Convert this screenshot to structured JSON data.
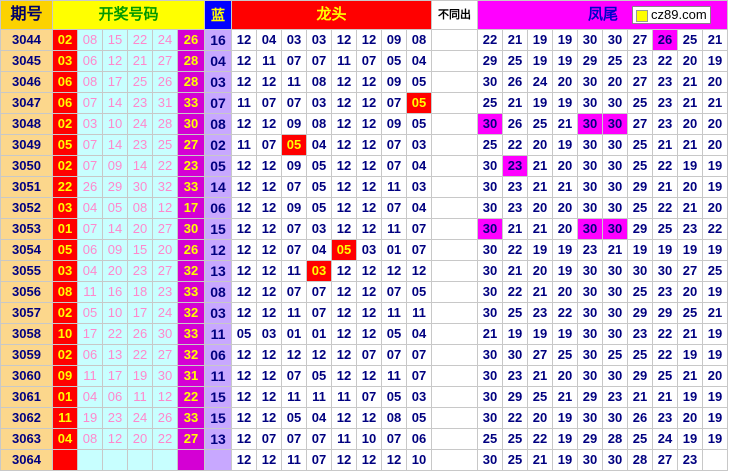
{
  "headers": {
    "period": "期号",
    "open_numbers": "开奖号码",
    "blue": "蓝",
    "dragon_head": "龙头",
    "not_same": "不同出",
    "phoenix_tail": "凤尾",
    "site": "cz89.com"
  },
  "rows": [
    {
      "period": "3044",
      "reds": [
        "02",
        "08",
        "15",
        "22",
        "24",
        "26"
      ],
      "blue": "16",
      "dragon": [
        "12",
        "04",
        "03",
        "03",
        "12",
        "12",
        "09",
        "08"
      ],
      "dragon_hit": -1,
      "tail": [
        "22",
        "21",
        "19",
        "19",
        "30",
        "30",
        "27",
        "26",
        "25",
        "21"
      ],
      "tail_hits": [
        7
      ]
    },
    {
      "period": "3045",
      "reds": [
        "03",
        "06",
        "12",
        "21",
        "27",
        "28"
      ],
      "blue": "04",
      "dragon": [
        "12",
        "11",
        "07",
        "07",
        "11",
        "07",
        "05",
        "04"
      ],
      "dragon_hit": -1,
      "tail": [
        "29",
        "25",
        "19",
        "19",
        "29",
        "25",
        "23",
        "22",
        "20",
        "19"
      ],
      "tail_hits": []
    },
    {
      "period": "3046",
      "reds": [
        "06",
        "08",
        "17",
        "25",
        "26",
        "28"
      ],
      "blue": "03",
      "dragon": [
        "12",
        "12",
        "11",
        "08",
        "12",
        "12",
        "09",
        "05"
      ],
      "dragon_hit": -1,
      "tail": [
        "30",
        "26",
        "24",
        "20",
        "30",
        "20",
        "27",
        "23",
        "21",
        "20"
      ],
      "tail_hits": []
    },
    {
      "period": "3047",
      "reds": [
        "06",
        "07",
        "14",
        "23",
        "31",
        "33"
      ],
      "blue": "07",
      "dragon": [
        "11",
        "07",
        "07",
        "03",
        "12",
        "12",
        "07",
        "05"
      ],
      "dragon_hit": 7,
      "tail": [
        "25",
        "21",
        "19",
        "19",
        "30",
        "30",
        "25",
        "23",
        "21",
        "21"
      ],
      "tail_hits": []
    },
    {
      "period": "3048",
      "reds": [
        "02",
        "03",
        "10",
        "24",
        "28",
        "30"
      ],
      "blue": "08",
      "dragon": [
        "12",
        "12",
        "09",
        "08",
        "12",
        "12",
        "09",
        "05"
      ],
      "dragon_hit": -1,
      "tail": [
        "30",
        "26",
        "25",
        "21",
        "30",
        "30",
        "27",
        "23",
        "20",
        "20"
      ],
      "tail_hits": [
        0,
        4,
        5
      ]
    },
    {
      "period": "3049",
      "reds": [
        "05",
        "07",
        "14",
        "23",
        "25",
        "27"
      ],
      "blue": "02",
      "dragon": [
        "11",
        "07",
        "05",
        "04",
        "12",
        "12",
        "07",
        "03"
      ],
      "dragon_hit": 2,
      "tail": [
        "25",
        "22",
        "20",
        "19",
        "30",
        "30",
        "25",
        "21",
        "21",
        "20"
      ],
      "tail_hits": []
    },
    {
      "period": "3050",
      "reds": [
        "02",
        "07",
        "09",
        "14",
        "22",
        "23"
      ],
      "blue": "05",
      "dragon": [
        "12",
        "12",
        "09",
        "05",
        "12",
        "12",
        "07",
        "04"
      ],
      "dragon_hit": -1,
      "tail": [
        "30",
        "23",
        "21",
        "20",
        "30",
        "30",
        "25",
        "22",
        "19",
        "19"
      ],
      "tail_hits": [
        1
      ]
    },
    {
      "period": "3051",
      "reds": [
        "22",
        "26",
        "29",
        "30",
        "32",
        "33"
      ],
      "blue": "14",
      "dragon": [
        "12",
        "12",
        "07",
        "05",
        "12",
        "12",
        "11",
        "03"
      ],
      "dragon_hit": -1,
      "tail": [
        "30",
        "23",
        "21",
        "21",
        "30",
        "30",
        "29",
        "21",
        "20",
        "19"
      ],
      "tail_hits": []
    },
    {
      "period": "3052",
      "reds": [
        "03",
        "04",
        "05",
        "08",
        "12",
        "17"
      ],
      "blue": "06",
      "dragon": [
        "12",
        "12",
        "09",
        "05",
        "12",
        "12",
        "07",
        "04"
      ],
      "dragon_hit": -1,
      "tail": [
        "30",
        "23",
        "20",
        "20",
        "30",
        "30",
        "25",
        "22",
        "21",
        "20"
      ],
      "tail_hits": []
    },
    {
      "period": "3053",
      "reds": [
        "01",
        "07",
        "14",
        "20",
        "27",
        "30"
      ],
      "blue": "15",
      "dragon": [
        "12",
        "12",
        "07",
        "03",
        "12",
        "12",
        "11",
        "07"
      ],
      "dragon_hit": -1,
      "tail": [
        "30",
        "21",
        "21",
        "20",
        "30",
        "30",
        "29",
        "25",
        "23",
        "22"
      ],
      "tail_hits": [
        0,
        4,
        5
      ]
    },
    {
      "period": "3054",
      "reds": [
        "05",
        "06",
        "09",
        "15",
        "20",
        "26"
      ],
      "blue": "12",
      "dragon": [
        "12",
        "12",
        "07",
        "04",
        "05",
        "03",
        "01",
        "07"
      ],
      "dragon_hit": 4,
      "tail": [
        "30",
        "22",
        "19",
        "19",
        "23",
        "21",
        "19",
        "19",
        "19",
        "19"
      ],
      "tail_hits": []
    },
    {
      "period": "3055",
      "reds": [
        "03",
        "04",
        "20",
        "23",
        "27",
        "32"
      ],
      "blue": "13",
      "dragon": [
        "12",
        "12",
        "11",
        "03",
        "12",
        "12",
        "12",
        "12"
      ],
      "dragon_hit": 3,
      "tail": [
        "30",
        "21",
        "20",
        "19",
        "30",
        "30",
        "30",
        "30",
        "27",
        "25"
      ],
      "tail_hits": []
    },
    {
      "period": "3056",
      "reds": [
        "08",
        "11",
        "16",
        "18",
        "23",
        "33"
      ],
      "blue": "08",
      "dragon": [
        "12",
        "12",
        "07",
        "07",
        "12",
        "12",
        "07",
        "05"
      ],
      "dragon_hit": -1,
      "tail": [
        "30",
        "22",
        "21",
        "20",
        "30",
        "30",
        "25",
        "23",
        "20",
        "19"
      ],
      "tail_hits": []
    },
    {
      "period": "3057",
      "reds": [
        "02",
        "05",
        "10",
        "17",
        "24",
        "32"
      ],
      "blue": "03",
      "dragon": [
        "12",
        "12",
        "11",
        "07",
        "12",
        "12",
        "11",
        "11"
      ],
      "dragon_hit": -1,
      "tail": [
        "30",
        "25",
        "23",
        "22",
        "30",
        "30",
        "29",
        "29",
        "25",
        "21"
      ],
      "tail_hits": []
    },
    {
      "period": "3058",
      "reds": [
        "10",
        "17",
        "22",
        "26",
        "30",
        "33"
      ],
      "blue": "11",
      "dragon": [
        "05",
        "03",
        "01",
        "01",
        "12",
        "12",
        "05",
        "04"
      ],
      "dragon_hit": -1,
      "tail": [
        "21",
        "19",
        "19",
        "19",
        "30",
        "30",
        "23",
        "22",
        "21",
        "19"
      ],
      "tail_hits": []
    },
    {
      "period": "3059",
      "reds": [
        "02",
        "06",
        "13",
        "22",
        "27",
        "32"
      ],
      "blue": "06",
      "dragon": [
        "12",
        "12",
        "12",
        "12",
        "12",
        "07",
        "07",
        "07"
      ],
      "dragon_hit": -1,
      "tail": [
        "30",
        "30",
        "27",
        "25",
        "30",
        "25",
        "25",
        "22",
        "19",
        "19"
      ],
      "tail_hits": []
    },
    {
      "period": "3060",
      "reds": [
        "09",
        "11",
        "17",
        "19",
        "30",
        "31"
      ],
      "blue": "11",
      "dragon": [
        "12",
        "12",
        "07",
        "05",
        "12",
        "12",
        "11",
        "07"
      ],
      "dragon_hit": -1,
      "tail": [
        "30",
        "23",
        "21",
        "20",
        "30",
        "30",
        "29",
        "25",
        "21",
        "20"
      ],
      "tail_hits": []
    },
    {
      "period": "3061",
      "reds": [
        "01",
        "04",
        "06",
        "11",
        "12",
        "22"
      ],
      "blue": "15",
      "dragon": [
        "12",
        "12",
        "11",
        "11",
        "11",
        "07",
        "05",
        "03"
      ],
      "dragon_hit": -1,
      "tail": [
        "30",
        "29",
        "25",
        "21",
        "29",
        "23",
        "21",
        "21",
        "19",
        "19"
      ],
      "tail_hits": []
    },
    {
      "period": "3062",
      "reds": [
        "11",
        "19",
        "23",
        "24",
        "26",
        "33"
      ],
      "blue": "15",
      "dragon": [
        "12",
        "12",
        "05",
        "04",
        "12",
        "12",
        "08",
        "05"
      ],
      "dragon_hit": -1,
      "tail": [
        "30",
        "22",
        "20",
        "19",
        "30",
        "30",
        "26",
        "23",
        "20",
        "19"
      ],
      "tail_hits": []
    },
    {
      "period": "3063",
      "reds": [
        "04",
        "08",
        "12",
        "20",
        "22",
        "27"
      ],
      "blue": "13",
      "dragon": [
        "12",
        "07",
        "07",
        "07",
        "11",
        "10",
        "07",
        "06"
      ],
      "dragon_hit": -1,
      "tail": [
        "25",
        "25",
        "22",
        "19",
        "29",
        "28",
        "25",
        "24",
        "19",
        "19"
      ],
      "tail_hits": []
    },
    {
      "period": "3064",
      "reds": [
        "",
        "",
        "",
        "",
        "",
        ""
      ],
      "blue": "",
      "dragon": [
        "12",
        "12",
        "11",
        "07",
        "12",
        "12",
        "12",
        "10"
      ],
      "dragon_hit": -1,
      "tail": [
        "30",
        "25",
        "21",
        "19",
        "30",
        "30",
        "28",
        "27",
        "23"
      ],
      "tail_hits": []
    }
  ]
}
